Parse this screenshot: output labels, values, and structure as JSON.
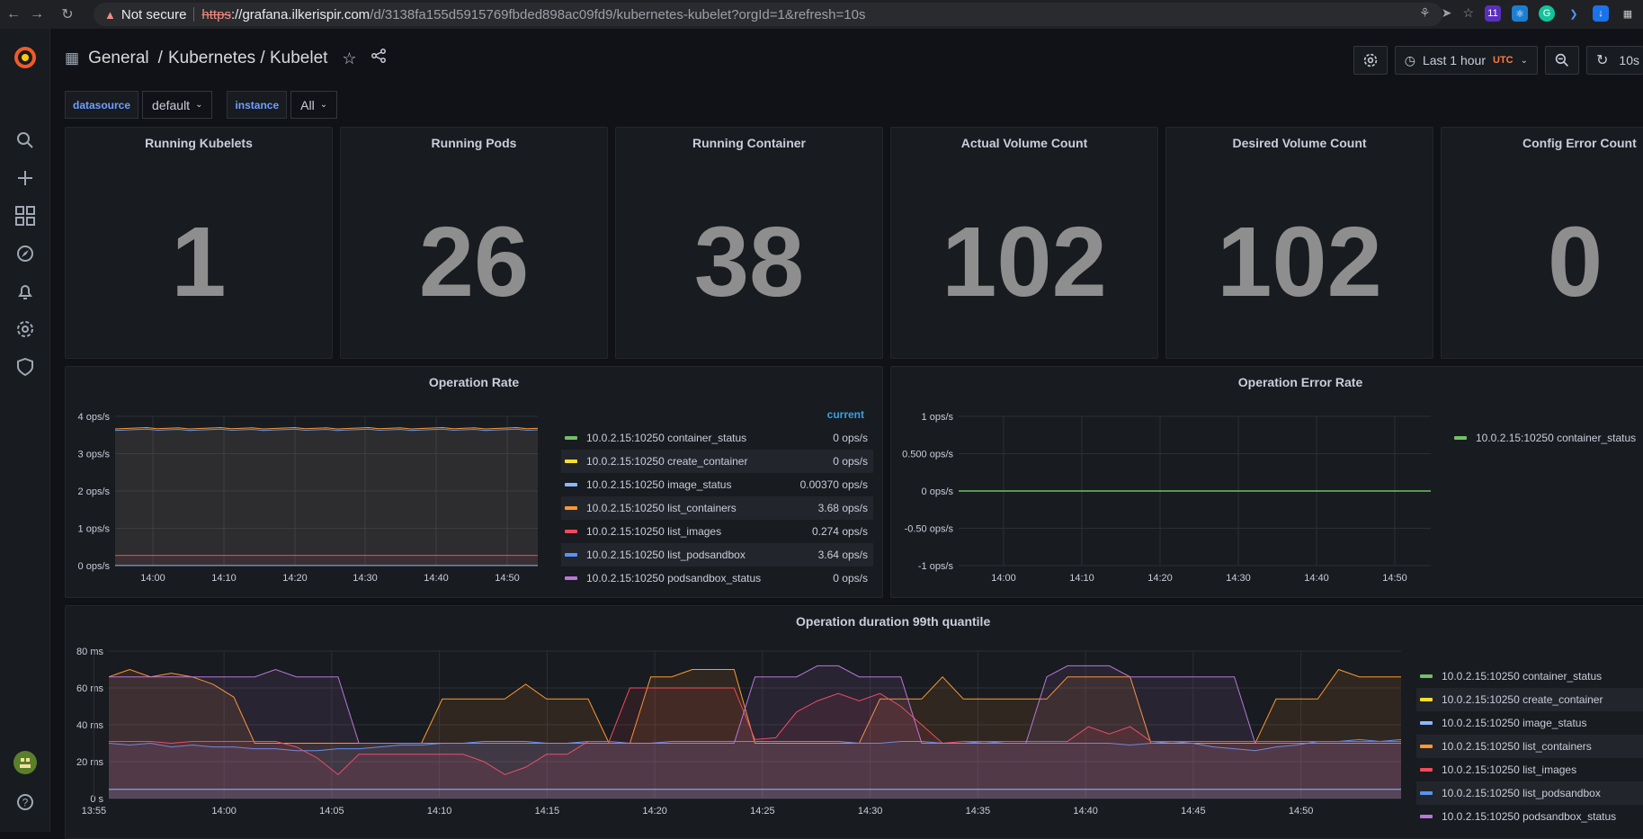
{
  "browser": {
    "not_secure": "Not secure",
    "url_scheme": "https",
    "url_host": "://grafana.ilkerispir.com",
    "url_path": "/d/3138fa155d5915769fbded898ac09fd9/kubernetes-kubelet?orgId=1&refresh=10s",
    "ext_badge": "11"
  },
  "breadcrumb": {
    "folder": "General",
    "sep": "/",
    "title": "Kubernetes / Kubelet"
  },
  "toolbar": {
    "time_range": "Last 1 hour",
    "timezone": "UTC",
    "refresh": "10s"
  },
  "variables": [
    {
      "label": "datasource",
      "value": "default"
    },
    {
      "label": "instance",
      "value": "All"
    }
  ],
  "stats": [
    {
      "title": "Running Kubelets",
      "value": "1"
    },
    {
      "title": "Running Pods",
      "value": "26"
    },
    {
      "title": "Running Container",
      "value": "38"
    },
    {
      "title": "Actual Volume Count",
      "value": "102"
    },
    {
      "title": "Desired Volume Count",
      "value": "102"
    },
    {
      "title": "Config Error Count",
      "value": "0"
    }
  ],
  "op_rate": {
    "title": "Operation Rate",
    "legend_header": "current",
    "legend": [
      {
        "name": "10.0.2.15:10250 container_status",
        "current": "0 ops/s",
        "color": "#73bf69"
      },
      {
        "name": "10.0.2.15:10250 create_container",
        "current": "0 ops/s",
        "color": "#fade2a"
      },
      {
        "name": "10.0.2.15:10250 image_status",
        "current": "0.00370 ops/s",
        "color": "#8ab8ff"
      },
      {
        "name": "10.0.2.15:10250 list_containers",
        "current": "3.68 ops/s",
        "color": "#ff9830"
      },
      {
        "name": "10.0.2.15:10250 list_images",
        "current": "0.274 ops/s",
        "color": "#f2495c"
      },
      {
        "name": "10.0.2.15:10250 list_podsandbox",
        "current": "3.64 ops/s",
        "color": "#5794f2"
      },
      {
        "name": "10.0.2.15:10250 podsandbox_status",
        "current": "0 ops/s",
        "color": "#b877d9"
      }
    ]
  },
  "op_error": {
    "title": "Operation Error Rate",
    "legend": [
      {
        "name": "10.0.2.15:10250 container_status",
        "color": "#73bf69"
      }
    ]
  },
  "op_duration": {
    "title": "Operation duration 99th quantile",
    "legend": [
      {
        "name": "10.0.2.15:10250 container_status",
        "color": "#73bf69"
      },
      {
        "name": "10.0.2.15:10250 create_container",
        "color": "#fade2a"
      },
      {
        "name": "10.0.2.15:10250 image_status",
        "color": "#8ab8ff"
      },
      {
        "name": "10.0.2.15:10250 list_containers",
        "color": "#ff9830"
      },
      {
        "name": "10.0.2.15:10250 list_images",
        "color": "#f2495c"
      },
      {
        "name": "10.0.2.15:10250 list_podsandbox",
        "color": "#5794f2"
      },
      {
        "name": "10.0.2.15:10250 podsandbox_status",
        "color": "#b877d9"
      }
    ]
  },
  "chart_data": [
    {
      "type": "area",
      "title": "Operation Rate",
      "x": [
        "14:00",
        "14:10",
        "14:20",
        "14:30",
        "14:40",
        "14:50"
      ],
      "yticks": [
        "4 ops/s",
        "3 ops/s",
        "2 ops/s",
        "1 ops/s",
        "0 ops/s"
      ],
      "ylim": [
        0,
        4
      ],
      "series": [
        {
          "name": "10.0.2.15:10250 list_containers",
          "value": 3.68
        },
        {
          "name": "10.0.2.15:10250 list_podsandbox",
          "value": 3.64
        },
        {
          "name": "10.0.2.15:10250 list_images",
          "value": 0.274
        },
        {
          "name": "10.0.2.15:10250 image_status",
          "value": 0.0037
        }
      ]
    },
    {
      "type": "line",
      "title": "Operation Error Rate",
      "x": [
        "14:00",
        "14:10",
        "14:20",
        "14:30",
        "14:40",
        "14:50"
      ],
      "yticks": [
        "1 ops/s",
        "0.500 ops/s",
        "0 ops/s",
        "-0.50 ops/s",
        "-1 ops/s"
      ],
      "ylim": [
        -1,
        1
      ],
      "series": [
        {
          "name": "10.0.2.15:10250 container_status",
          "value": 0
        }
      ]
    },
    {
      "type": "area",
      "title": "Operation duration 99th quantile",
      "x": [
        "13:55",
        "14:00",
        "14:05",
        "14:10",
        "14:15",
        "14:20",
        "14:25",
        "14:30",
        "14:35",
        "14:40",
        "14:45",
        "14:50"
      ],
      "yticks": [
        "80 ms",
        "60 ms",
        "40 ms",
        "20 ms",
        "0 s"
      ],
      "ylim": [
        0,
        80
      ],
      "series": [
        {
          "name": "10.0.2.15:10250 list_containers",
          "values": [
            66,
            70,
            66,
            68,
            66,
            62,
            55,
            30,
            30,
            30,
            30,
            30,
            30,
            30,
            30,
            30,
            54,
            54,
            54,
            54,
            62,
            54,
            54,
            54,
            30,
            30,
            66,
            66,
            70,
            70,
            70,
            30,
            30,
            30,
            30,
            30,
            30,
            54,
            54,
            54,
            66,
            54,
            54,
            54,
            54,
            54,
            66,
            66,
            66,
            66,
            30,
            30,
            30,
            30,
            30,
            30,
            54,
            54,
            54,
            70,
            66,
            66,
            66
          ]
        },
        {
          "name": "10.0.2.15:10250 list_podsandbox",
          "values": [
            30,
            29,
            30,
            28,
            29,
            28,
            28,
            27,
            27,
            26,
            26,
            27,
            27,
            28,
            29,
            29,
            30,
            30,
            31,
            31,
            31,
            30,
            30,
            31,
            31,
            30,
            30,
            31,
            31,
            31,
            31,
            31,
            31,
            31,
            31,
            31,
            30,
            30,
            31,
            31,
            30,
            30,
            31,
            30,
            30,
            30,
            30,
            30,
            30,
            29,
            30,
            31,
            30,
            28,
            27,
            26,
            28,
            29,
            31,
            31,
            32,
            31,
            32
          ]
        },
        {
          "name": "10.0.2.15:10250 list_images",
          "values": [
            31,
            31,
            31,
            30,
            31,
            31,
            31,
            31,
            31,
            28,
            22,
            13,
            24,
            24,
            24,
            24,
            24,
            24,
            20,
            13,
            17,
            24,
            24,
            31,
            31,
            60,
            60,
            60,
            60,
            60,
            60,
            32,
            33,
            47,
            53,
            57,
            53,
            57,
            50,
            40,
            30,
            31,
            31,
            31,
            31,
            31,
            31,
            39,
            35,
            39,
            31,
            31,
            31,
            31,
            31,
            31,
            31,
            31,
            31,
            31,
            31,
            31,
            31
          ]
        },
        {
          "name": "10.0.2.15:10250 podsandbox_status",
          "values": [
            66,
            66,
            66,
            66,
            66,
            66,
            66,
            66,
            70,
            66,
            66,
            66,
            30,
            30,
            30,
            30,
            30,
            30,
            30,
            30,
            30,
            30,
            30,
            30,
            30,
            30,
            30,
            30,
            30,
            30,
            30,
            66,
            66,
            66,
            72,
            72,
            66,
            66,
            66,
            30,
            30,
            30,
            30,
            30,
            30,
            66,
            72,
            72,
            72,
            66,
            66,
            66,
            66,
            66,
            66,
            30,
            30,
            30,
            30,
            30,
            30,
            30,
            30
          ]
        },
        {
          "name": "10.0.2.15:10250 image_status",
          "values": [
            5,
            5,
            5,
            5,
            5,
            5,
            5,
            5,
            5,
            5,
            5,
            5,
            5,
            5,
            5,
            5,
            5,
            5,
            5,
            5,
            5,
            5,
            5,
            5,
            5,
            5,
            5,
            5,
            5,
            5,
            5,
            5,
            5,
            5,
            5,
            5,
            5,
            5,
            5,
            5,
            5,
            5,
            5,
            5,
            5,
            5,
            5,
            5,
            5,
            5,
            5,
            5,
            5,
            5,
            5,
            5,
            5,
            5,
            5,
            5,
            5,
            5,
            5
          ]
        }
      ]
    }
  ],
  "colors": {
    "accent": "#33a2e5",
    "warning": "#ff7941",
    "panel_bg": "#181b1f",
    "page_bg": "#111217"
  }
}
